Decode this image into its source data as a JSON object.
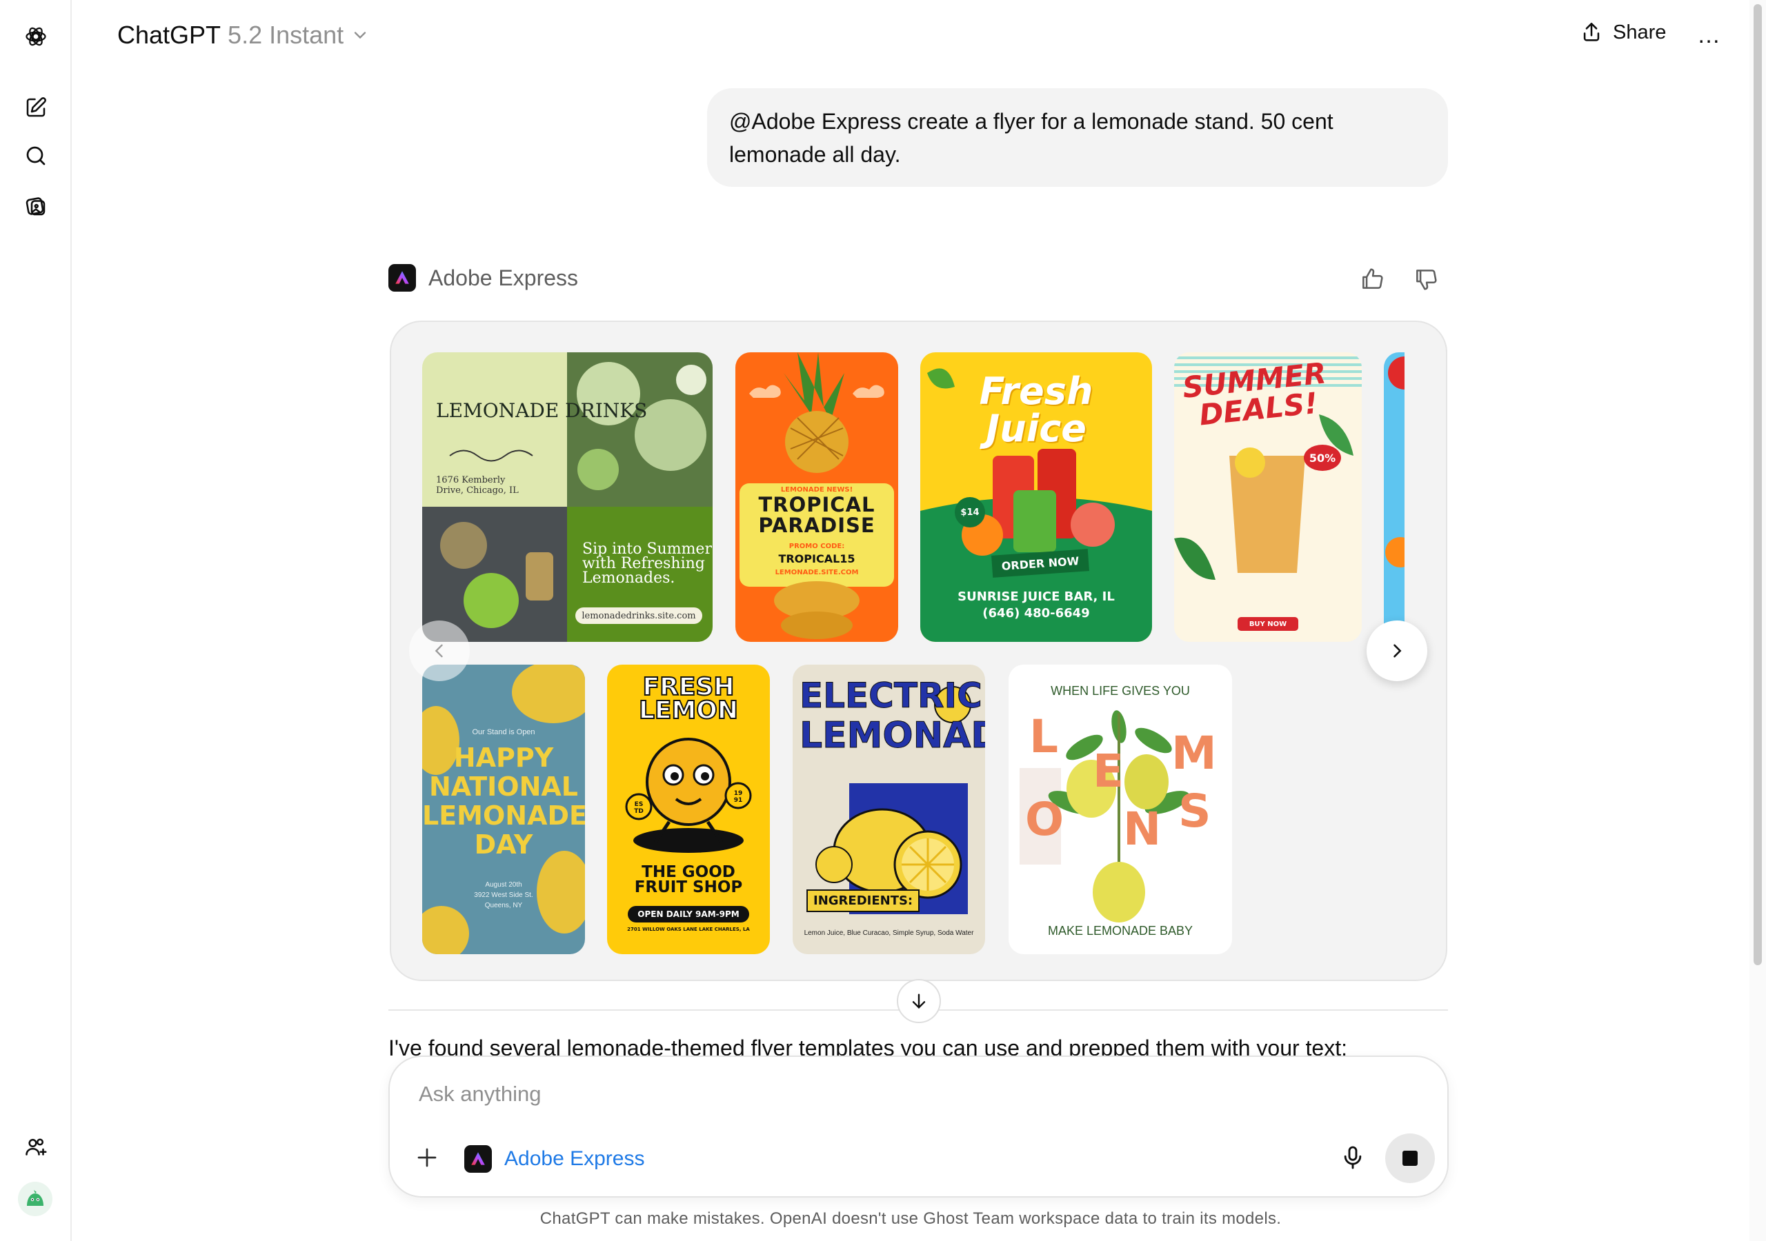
{
  "header": {
    "app_name": "ChatGPT",
    "model_version": "5.2 Instant",
    "share_label": "Share",
    "more_label": "…"
  },
  "conversation": {
    "user_message": "@Adobe Express create a flyer for a lemonade stand. 50 cent lemonade all day.",
    "tool_name": "Adobe Express",
    "assistant_reply": "I've found several lemonade-themed flyer templates you can use and prepped them with your text:"
  },
  "templates": [
    {
      "title": "LEMONADE DRINKS",
      "address_line1": "1676 Kemberly",
      "address_line2": "Drive, Chicago, IL",
      "tagline_line1": "Sip into Summer",
      "tagline_line2": "with Refreshing",
      "tagline_line3": "Lemonades.",
      "url": "lemonadedrinks.site.com"
    },
    {
      "kicker": "LEMONADE NEWS!",
      "title_line1": "TROPICAL",
      "title_line2": "PARADISE",
      "promo_label": "PROMO CODE:",
      "promo_code": "TROPICAL15",
      "url": "LEMONADE.SITE.COM"
    },
    {
      "title_line1": "Fresh",
      "title_line2": "Juice",
      "price": "$14",
      "cta": "ORDER NOW",
      "business": "SUNRISE JUICE BAR, IL",
      "phone": "(646) 480-6649"
    },
    {
      "title_line1": "SUMMER",
      "title_line2": "DEALS!",
      "discount": "50%",
      "cta": "BUY NOW"
    },
    {
      "kicker": "Our Stand is Open",
      "title_line1": "HAPPY",
      "title_line2": "NATIONAL",
      "title_line3": "LEMONADE",
      "title_line4": "DAY",
      "date": "August 20th",
      "address_line1": "3922 West Side St.",
      "address_line2": "Queens, NY"
    },
    {
      "title_line1": "FRESH",
      "title_line2": "LEMON",
      "badge_left": "ES TD",
      "badge_right": "19 91",
      "shop_line1": "THE GOOD",
      "shop_line2": "FRUIT SHOP",
      "hours": "OPEN DAILY 9AM-9PM",
      "address": "2701 WILLOW OAKS LANE LAKE CHARLES, LA"
    },
    {
      "title_line1": "ELECTRIC",
      "title_line2": "LEMONADE",
      "ingredients_label": "INGREDIENTS:",
      "ingredients": "Lemon Juice, Blue Curacao, Simple Syrup, Soda Water"
    },
    {
      "top_text": "WHEN LIFE GIVES YOU",
      "bottom_text": "MAKE LEMONADE BABY",
      "letters": [
        "L",
        "E",
        "M",
        "O",
        "N",
        "S"
      ]
    }
  ],
  "composer": {
    "placeholder": "Ask anything",
    "tool_chip": "Adobe Express"
  },
  "footer": {
    "disclaimer": "ChatGPT can make mistakes. OpenAI doesn't use Ghost Team workspace data to train its models."
  },
  "icons": {
    "logo": "openai-logo-icon",
    "new_chat": "edit-icon",
    "search": "search-icon",
    "library": "images-icon",
    "team": "add-people-icon",
    "share": "upload-icon",
    "thumbs_up": "thumbs-up-icon",
    "thumbs_down": "thumbs-down-icon",
    "mic": "microphone-icon",
    "stop": "stop-icon",
    "scroll_down": "arrow-down-icon"
  },
  "colors": {
    "link_blue": "#1f7ae6",
    "bubble_bg": "#f3f3f3",
    "carousel_bg": "#f3f3f3"
  }
}
